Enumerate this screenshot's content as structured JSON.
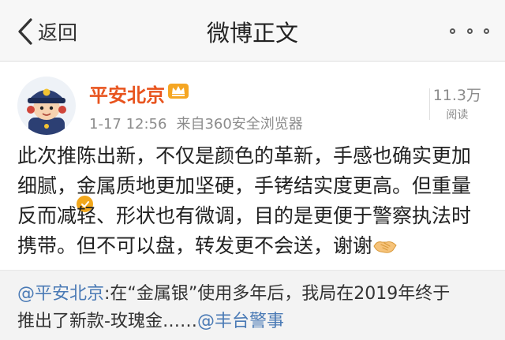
{
  "nav": {
    "back_label": "返回",
    "title": "微博正文"
  },
  "post": {
    "username": "平安北京",
    "time": "1-17 12:56",
    "source": "来自360安全浏览器",
    "reads_count": "11.3万",
    "reads_label": "阅读",
    "content_lines": [
      "此次推陈出新，不仅是颜色的革新，手感也确实更加",
      "细腻，金属质地更加坚硬，手铐结实度更高。但重量",
      "反而减轻、形状也有微调，目的是更便于警察执法时",
      "携带。但不可以盘，转发更不会送，谢谢"
    ]
  },
  "repost": {
    "author_mention": "@平安北京",
    "line1_rest": ":在“金属银”使用多年后，我局在2019年终于",
    "line2_text": "推出了新款-玫瑰金……",
    "mention2": "@丰台警事"
  },
  "icons": {
    "back": "chevron-left-icon",
    "more": "more-dots-icon",
    "crown": "crown-badge-icon",
    "verified": "verified-badge-icon",
    "emoji": "handshake-emoji-icon"
  },
  "colors": {
    "username": "#e8541e",
    "link": "#4a7ab5",
    "meta": "#8c8c8c",
    "verified": "#f2a71b"
  }
}
